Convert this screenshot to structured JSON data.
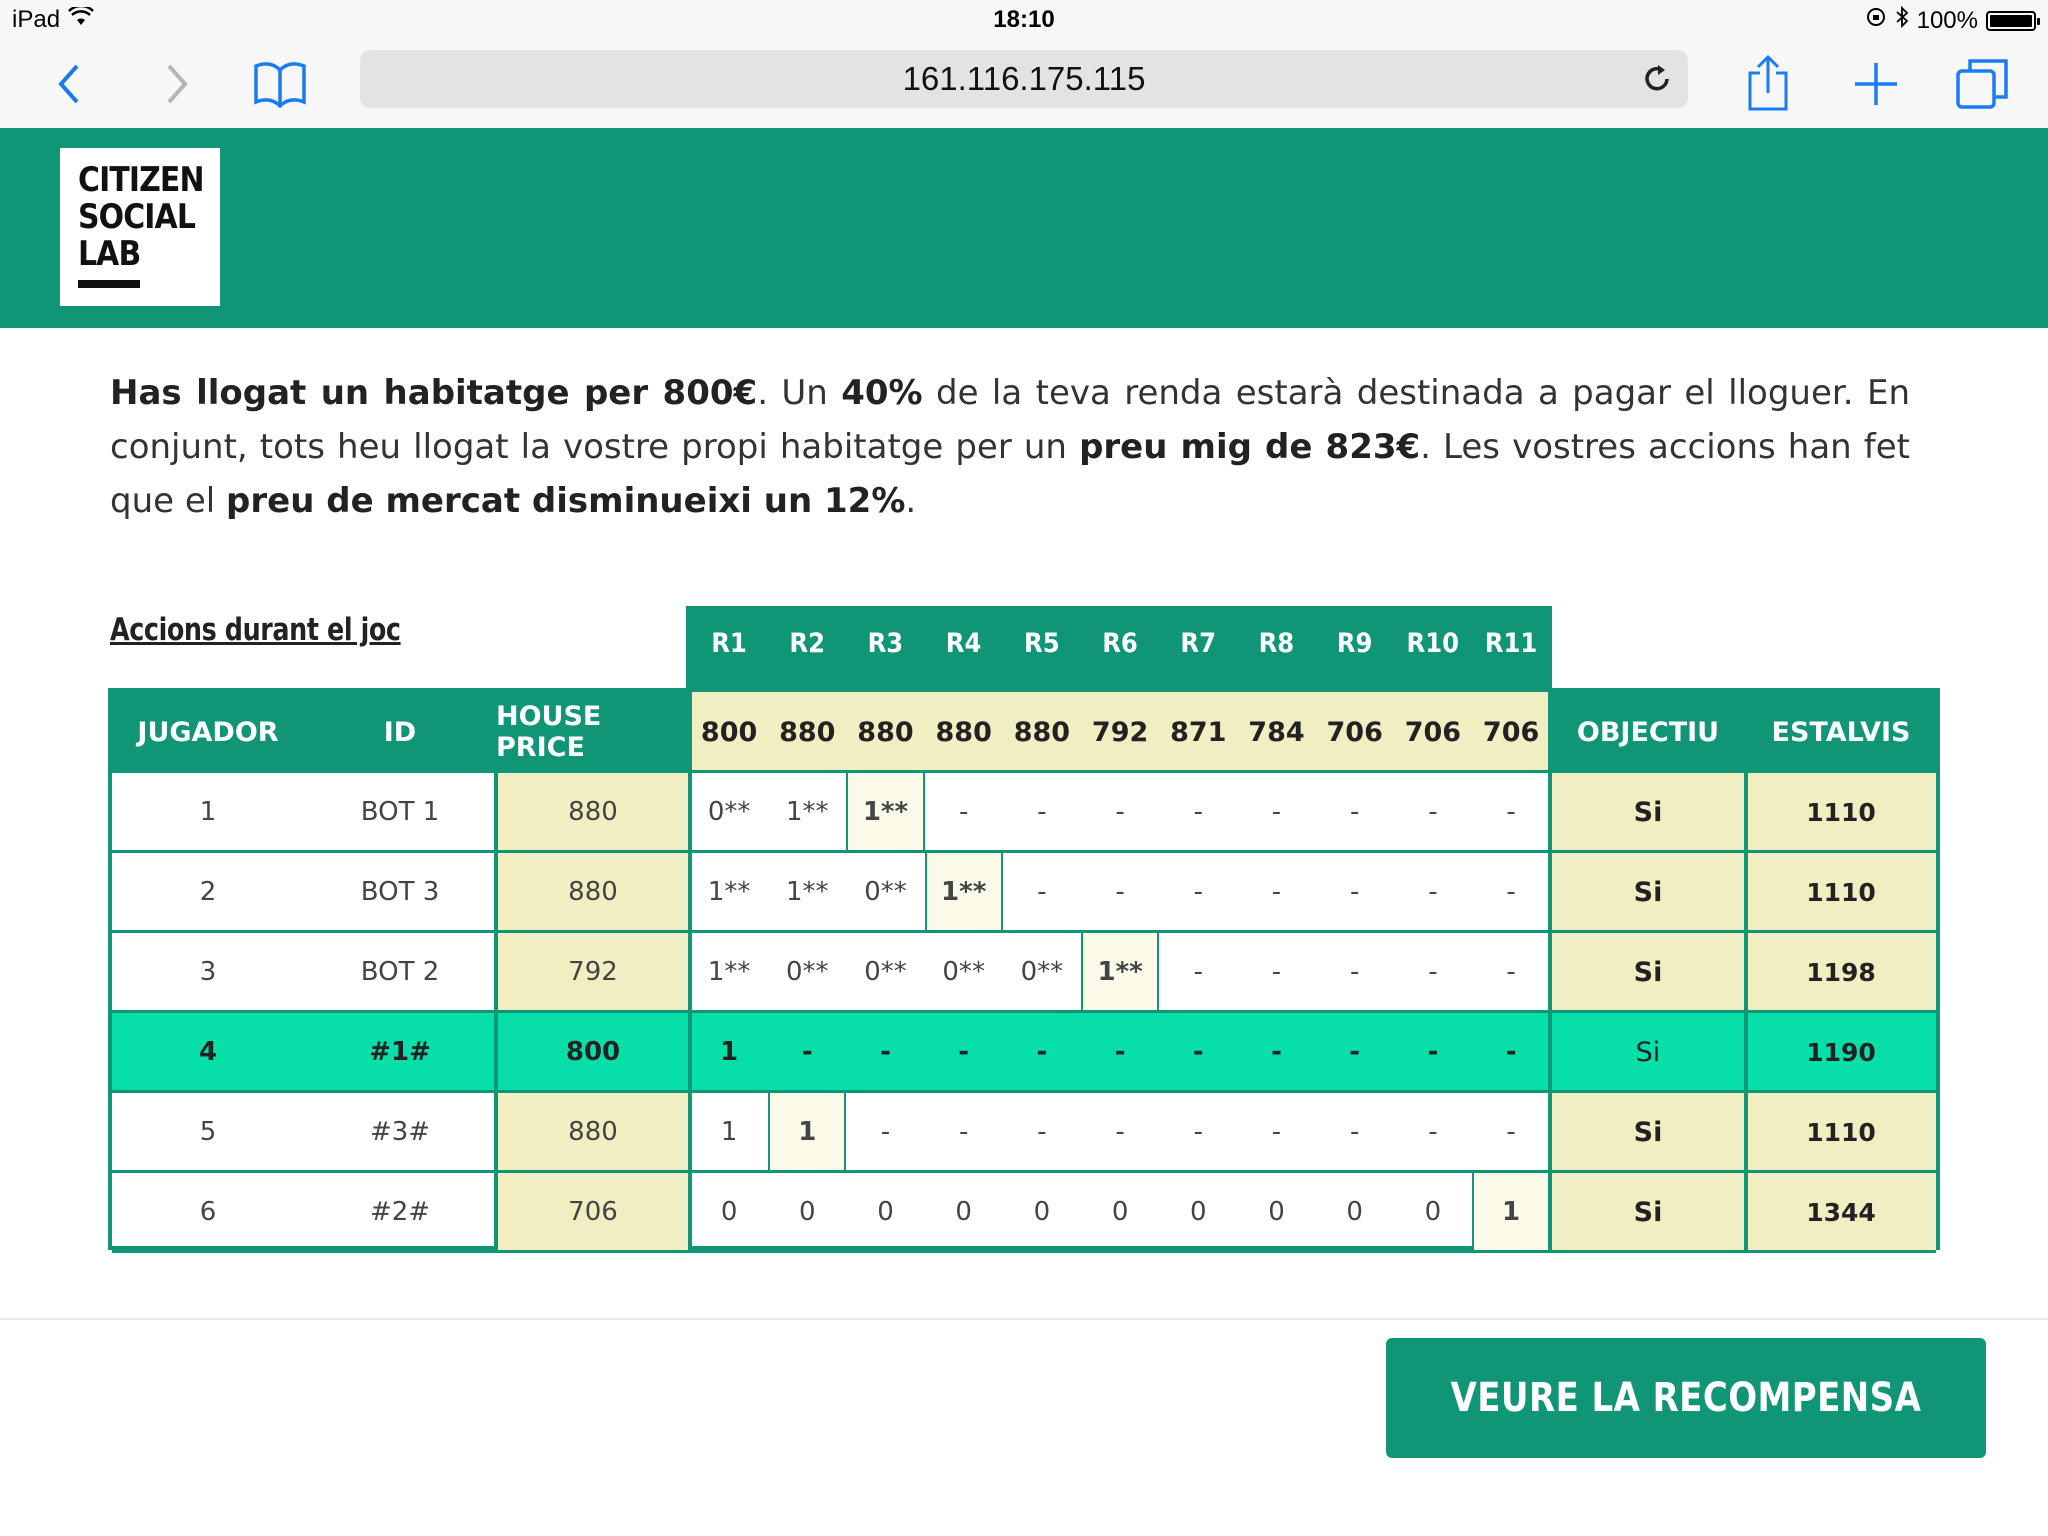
{
  "status_bar": {
    "device": "iPad",
    "time": "18:10",
    "battery": "100%",
    "battery_level": 1.0
  },
  "browser": {
    "url": "161.116.175.115"
  },
  "logo": {
    "lines": [
      "CITIZEN",
      "SOCIAL",
      "LAB"
    ]
  },
  "intro": {
    "p1": "Has llogat un habitatge per 800€",
    "p2": ". Un ",
    "p3": "40%",
    "p4": " de la teva renda estarà destinada a pagar el lloguer. En conjunt, tots heu llogat la vostre propi habitatge per un ",
    "p5": "preu mig de 823€",
    "p6": ". Les vostres accions han fet que el ",
    "p7": "preu de mercat disminueixi un 12%",
    "p8": "."
  },
  "section_title": "Accions durant el joc",
  "table": {
    "rounds": [
      "R1",
      "R2",
      "R3",
      "R4",
      "R5",
      "R6",
      "R7",
      "R8",
      "R9",
      "R10",
      "R11"
    ],
    "headers": {
      "player": "JUGADOR",
      "id": "ID",
      "house_price": "HOUSE PRICE",
      "objective": "OBJECTIU",
      "savings": "ESTALVIS"
    },
    "round_prices": [
      "800",
      "880",
      "880",
      "880",
      "880",
      "792",
      "871",
      "784",
      "706",
      "706",
      "706"
    ],
    "rows": [
      {
        "player": "1",
        "id": "BOT 1",
        "price": "880",
        "actions": [
          "0**",
          "1**",
          "1**",
          "-",
          "-",
          "-",
          "-",
          "-",
          "-",
          "-",
          "-"
        ],
        "objective": "Si",
        "savings": "1110"
      },
      {
        "player": "2",
        "id": "BOT 3",
        "price": "880",
        "actions": [
          "1**",
          "1**",
          "0**",
          "1**",
          "-",
          "-",
          "-",
          "-",
          "-",
          "-",
          "-"
        ],
        "objective": "Si",
        "savings": "1110"
      },
      {
        "player": "3",
        "id": "BOT 2",
        "price": "792",
        "actions": [
          "1**",
          "0**",
          "0**",
          "0**",
          "0**",
          "1**",
          "-",
          "-",
          "-",
          "-",
          "-"
        ],
        "objective": "Si",
        "savings": "1198"
      },
      {
        "player": "4",
        "id": "#1#",
        "price": "800",
        "actions": [
          "1",
          "-",
          "-",
          "-",
          "-",
          "-",
          "-",
          "-",
          "-",
          "-",
          "-"
        ],
        "objective": "Si",
        "savings": "1190"
      },
      {
        "player": "5",
        "id": "#3#",
        "price": "880",
        "actions": [
          "1",
          "1",
          "-",
          "-",
          "-",
          "-",
          "-",
          "-",
          "-",
          "-",
          "-"
        ],
        "objective": "Si",
        "savings": "1110"
      },
      {
        "player": "6",
        "id": "#2#",
        "price": "706",
        "actions": [
          "0",
          "0",
          "0",
          "0",
          "0",
          "0",
          "0",
          "0",
          "0",
          "0",
          "1"
        ],
        "objective": "Si",
        "savings": "1344"
      }
    ],
    "highlight": [
      2,
      3,
      5,
      null,
      1,
      10
    ]
  },
  "button": {
    "label": "VEURE LA RECOMPENSA"
  }
}
